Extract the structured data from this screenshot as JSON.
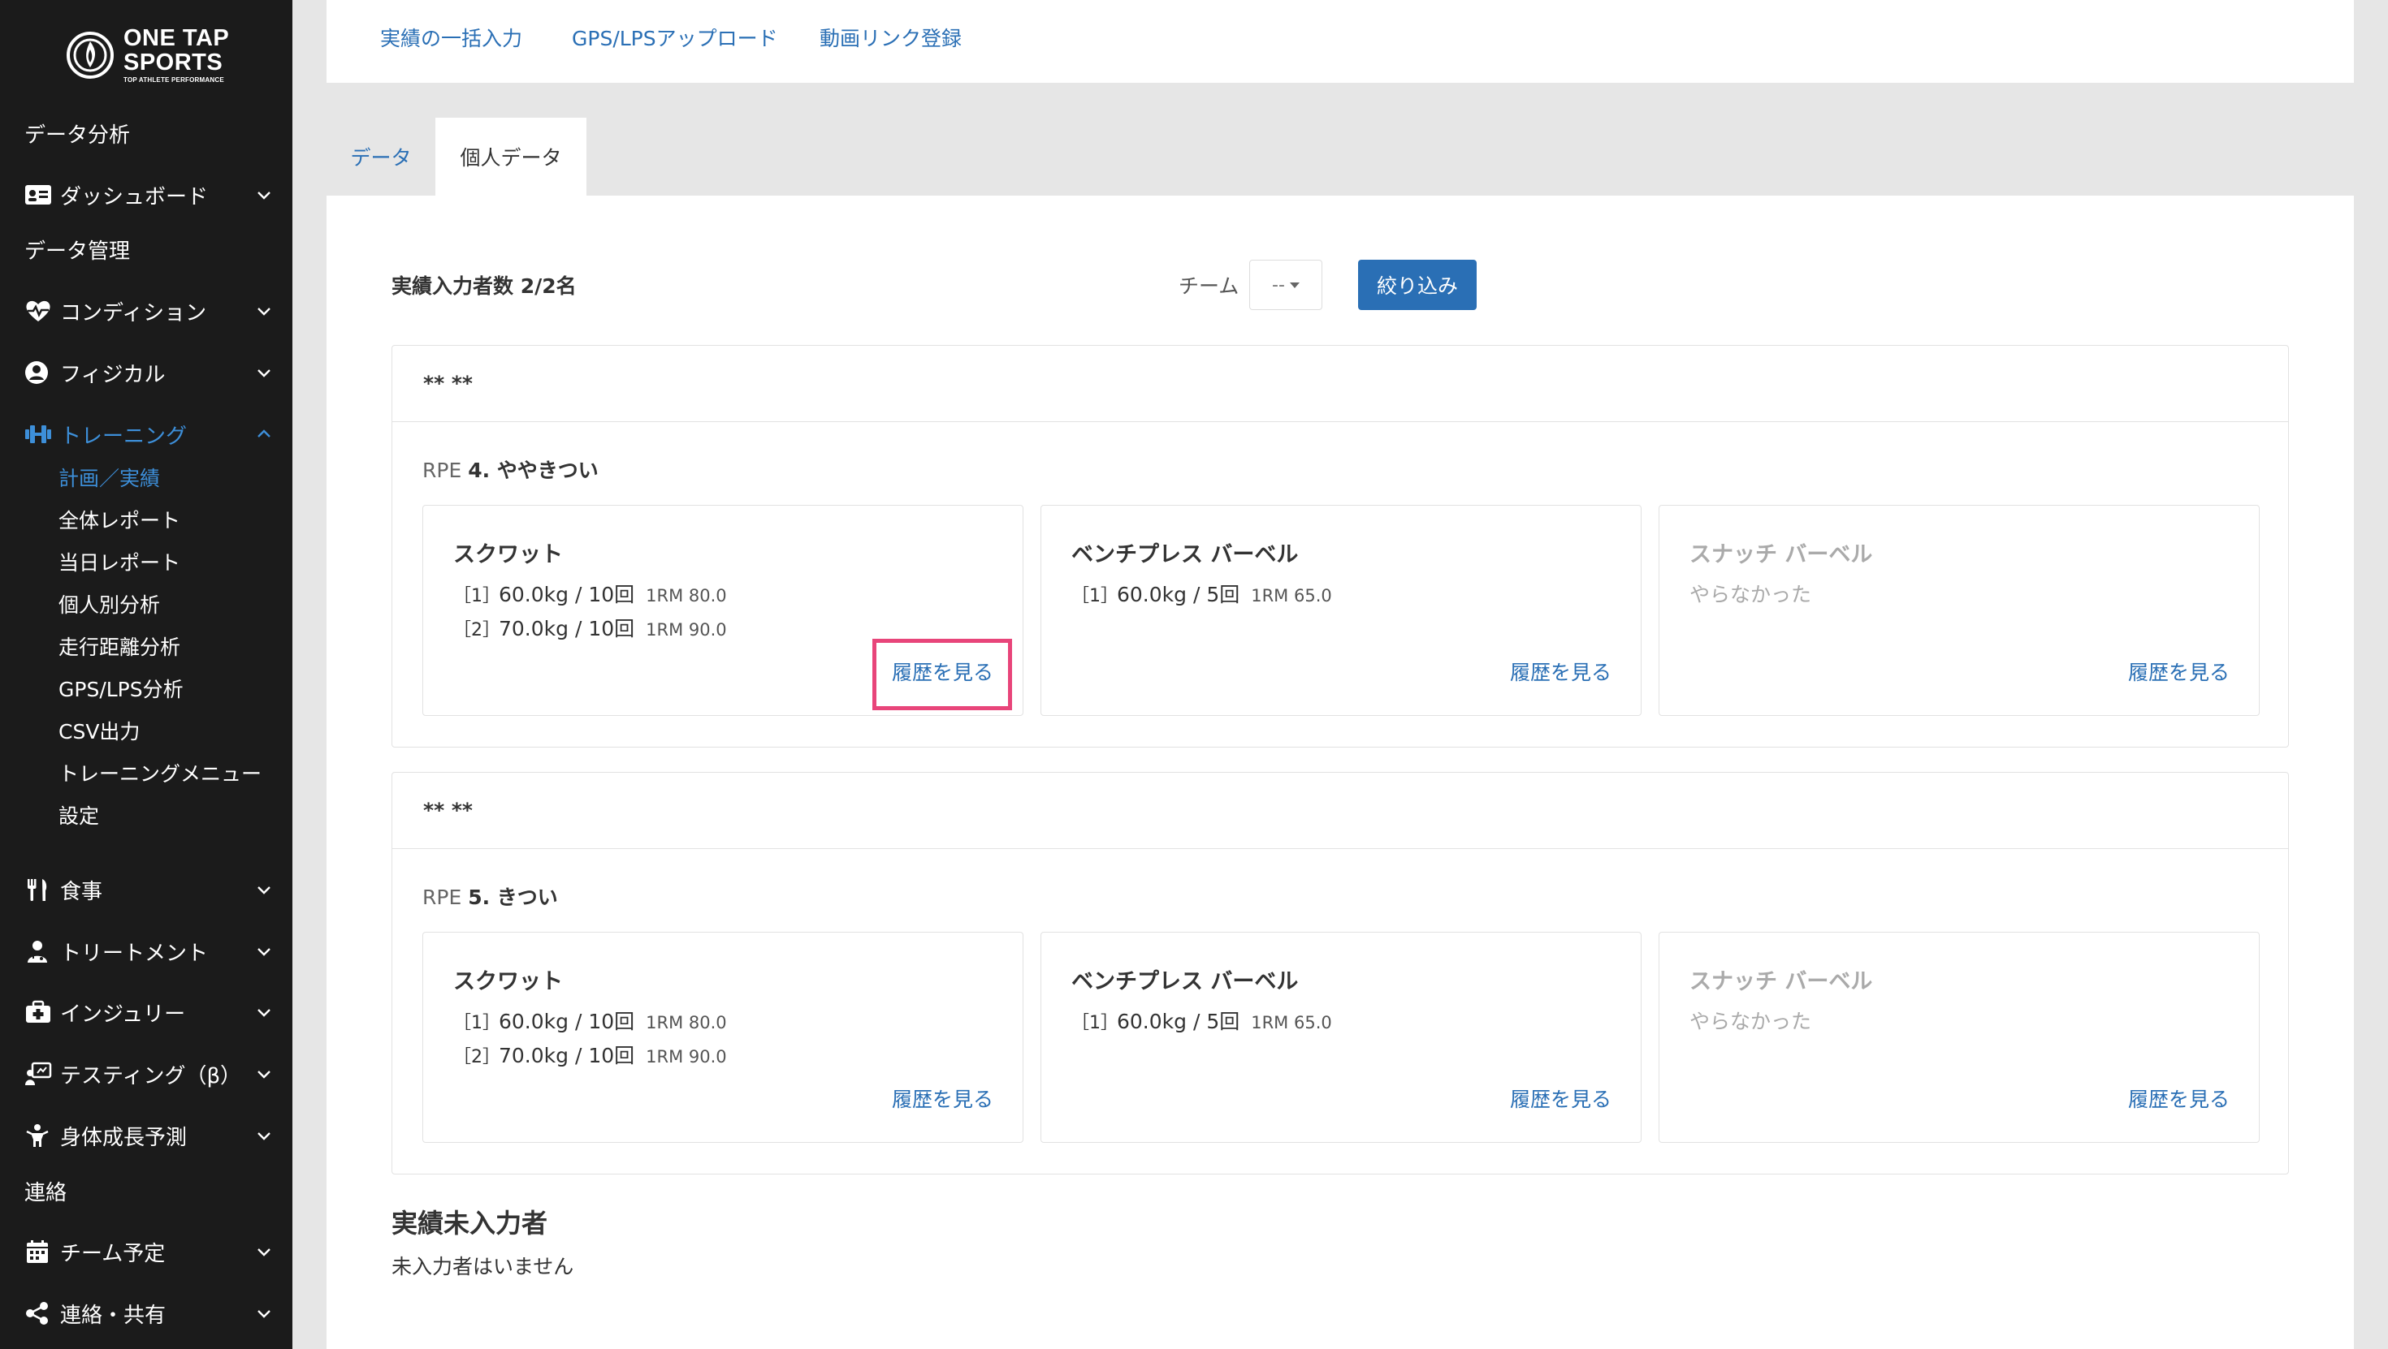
{
  "brand": {
    "line1": "ONE TAP",
    "line2": "SPORTS",
    "line3": "TOP ATHLETE PERFORMANCE"
  },
  "sidebar": {
    "section_analysis": "データ分析",
    "dashboard": "ダッシュボード",
    "section_manage": "データ管理",
    "condition": "コンディション",
    "physical": "フィジカル",
    "training": "トレーニング",
    "training_sub": [
      "計画／実績",
      "全体レポート",
      "当日レポート",
      "個人別分析",
      "走行距離分析",
      "GPS/LPS分析",
      "CSV出力",
      "トレーニングメニュー",
      "設定"
    ],
    "meal": "食事",
    "treatment": "トリートメント",
    "injury": "インジュリー",
    "testing": "テスティング（β）",
    "growth": "身体成長予測",
    "section_contact": "連絡",
    "schedule": "チーム予定",
    "share": "連絡・共有"
  },
  "topbar": {
    "links": [
      "実績の一括入力",
      "GPS/LPSアップロード",
      "動画リンク登録"
    ]
  },
  "tabs": {
    "data": "データ",
    "personal": "個人データ"
  },
  "filters": {
    "count_label": "実績入力者数 2/2名",
    "team_label": "チーム",
    "team_value": "--",
    "filter_button": "絞り込み"
  },
  "athletes": [
    {
      "name": "** **",
      "rpe_prefix": "RPE",
      "rpe_value": "4. ややきつい",
      "exercises": [
        {
          "name": "スクワット",
          "sets": [
            {
              "idx": "［1］",
              "val": "60.0kg / 10回",
              "rm": "1RM 80.0"
            },
            {
              "idx": "［2］",
              "val": "70.0kg / 10回",
              "rm": "1RM 90.0"
            }
          ],
          "history": "履歴を見る"
        },
        {
          "name": "ベンチプレス バーベル",
          "sets": [
            {
              "idx": "［1］",
              "val": "60.0kg / 5回",
              "rm": "1RM 65.0"
            }
          ],
          "history": "履歴を見る"
        },
        {
          "name": "スナッチ バーベル",
          "none": "やらなかった",
          "history": "履歴を見る"
        }
      ]
    },
    {
      "name": "** **",
      "rpe_prefix": "RPE",
      "rpe_value": "5. きつい",
      "exercises": [
        {
          "name": "スクワット",
          "sets": [
            {
              "idx": "［1］",
              "val": "60.0kg / 10回",
              "rm": "1RM 80.0"
            },
            {
              "idx": "［2］",
              "val": "70.0kg / 10回",
              "rm": "1RM 90.0"
            }
          ],
          "history": "履歴を見る"
        },
        {
          "name": "ベンチプレス バーベル",
          "sets": [
            {
              "idx": "［1］",
              "val": "60.0kg / 5回",
              "rm": "1RM 65.0"
            }
          ],
          "history": "履歴を見る"
        },
        {
          "name": "スナッチ バーベル",
          "none": "やらなかった",
          "history": "履歴を見る"
        }
      ]
    }
  ],
  "missing": {
    "title": "実績未入力者",
    "text": "未入力者はいません"
  },
  "colors": {
    "sidebar_bg": "#1b1b1b",
    "accent": "#2a6fb5",
    "active_nav": "#3d8fd9",
    "highlight": "#e8457a"
  }
}
